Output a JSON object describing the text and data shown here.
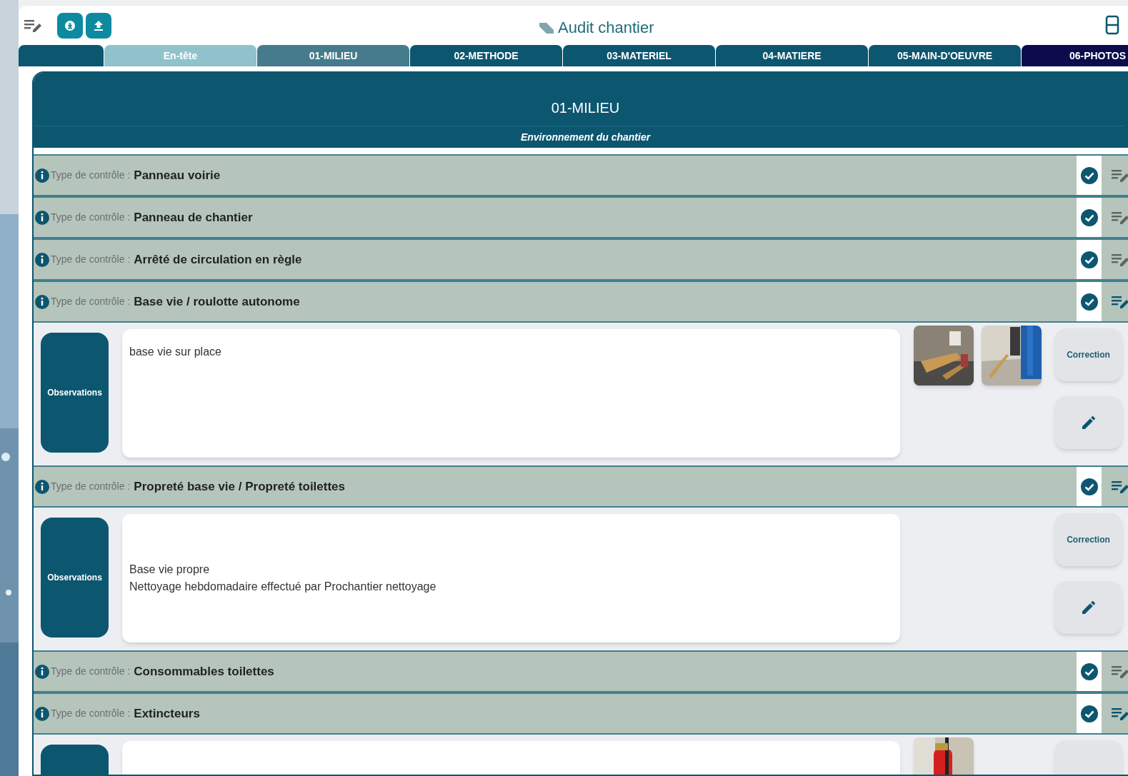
{
  "header": {
    "title": "Audit chantier"
  },
  "tabs": [
    {
      "kind": "blank",
      "selected": false
    },
    {
      "kind": "header",
      "label": "En-tête",
      "selected": false
    },
    {
      "kind": "section",
      "label": "01-MILIEU",
      "selected": true
    },
    {
      "kind": "section",
      "label": "02-METHODE",
      "selected": false
    },
    {
      "kind": "section",
      "label": "03-MATERIEL",
      "selected": false
    },
    {
      "kind": "section",
      "label": "04-MATIERE",
      "selected": false
    },
    {
      "kind": "section",
      "label": "05-MAIN-D'OEUVRE",
      "selected": false
    },
    {
      "kind": "photos",
      "label": "06-PHOTOS",
      "selected": false
    }
  ],
  "section": {
    "title": "01-MILIEU",
    "subtitle": "Environnement du chantier"
  },
  "controls": [
    {
      "prefix": "Type de contrôle :",
      "name": "Panneau voirie",
      "checked": true,
      "expanded": false
    },
    {
      "prefix": "Type de contrôle :",
      "name": "Panneau de chantier",
      "checked": true,
      "expanded": false
    },
    {
      "prefix": "Type de contrôle :",
      "name": "Arrêté de circulation en règle",
      "checked": true,
      "expanded": false
    },
    {
      "prefix": "Type de contrôle :",
      "name": "Base vie / roulotte autonome",
      "checked": true,
      "expanded": true,
      "observation": {
        "label": "Observations",
        "lines": [
          "base vie sur place"
        ],
        "photos": [
          {
            "kind": "picture"
          },
          {
            "kind": "picture"
          }
        ],
        "correction": "Correction"
      }
    },
    {
      "prefix": "Type de contrôle :",
      "name": "Propreté base vie / Propreté toilettes",
      "checked": true,
      "expanded": true,
      "observation": {
        "label": "Observations",
        "lines": [
          "Base vie propre",
          "Nettoyage hebdomadaire effectué par Prochantier nettoyage"
        ],
        "correction": "Correction"
      }
    },
    {
      "prefix": "Type de contrôle :",
      "name": "Consommables toilettes",
      "checked": true,
      "expanded": false
    },
    {
      "prefix": "Type de contrôle :",
      "name": "Extincteurs",
      "checked": true,
      "expanded": true,
      "observation": {
        "photos": [
          {
            "kind": "picture"
          }
        ]
      }
    }
  ]
}
